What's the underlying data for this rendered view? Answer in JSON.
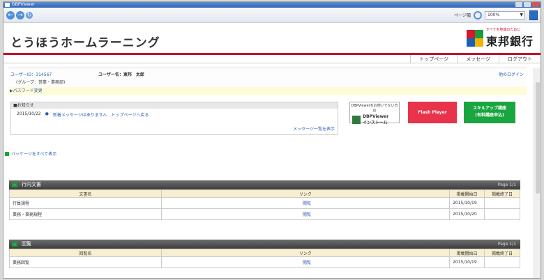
{
  "window": {
    "title": "DBPViewer"
  },
  "toolbar": {
    "page_width_label": "ページ幅",
    "zoom": "100%"
  },
  "site": {
    "title": "とうほうホームラーニング",
    "bank_tagline": "すべてを地域のために",
    "bank_name": "東邦銀行"
  },
  "nav": [
    "トップページ",
    "メッセージ",
    "ログアウト"
  ],
  "user": {
    "id_label": "ユーザーID：314567",
    "name_label": "ユーザー名：東邦　太郎",
    "group_label": "(グループ：営業・業務部)",
    "logout_link": "他のログイン"
  },
  "password_link": "▶パスワード変更",
  "notice": {
    "header": "■お知らせ",
    "date": "2015/10/22",
    "mail_text": "新着メッセージはありません",
    "link_text": "トップページへ戻る",
    "more": "メッセージ一覧を表示"
  },
  "banners": {
    "dbp_small": "DBPViewerをお使いでない方は",
    "dbp_large": "DBPViewer\nインストール",
    "flash": "Flash Player",
    "skill": "スキルアップ講座\n(有料講座申込)"
  },
  "packages_link": "パッケージをすべて表示",
  "section1": {
    "title": "行内文書",
    "page_label": "Page 1/1",
    "headers": [
      "文書名",
      "リンク",
      "掲載開始日",
      "掲載終了日"
    ],
    "rows": [
      {
        "name": "行員規程",
        "link": "閲覧",
        "start": "2015/10/19",
        "end": ""
      },
      {
        "name": "業務・事務規程",
        "link": "閲覧",
        "start": "2015/10/20",
        "end": ""
      }
    ]
  },
  "section2": {
    "title": "回覧",
    "page_label": "Page 1/1",
    "headers": [
      "回覧名",
      "リンク",
      "掲載開始日",
      "掲載終了日"
    ],
    "rows": [
      {
        "name": "業務回覧",
        "link": "閲覧",
        "start": "2015/10/19",
        "end": ""
      }
    ]
  }
}
